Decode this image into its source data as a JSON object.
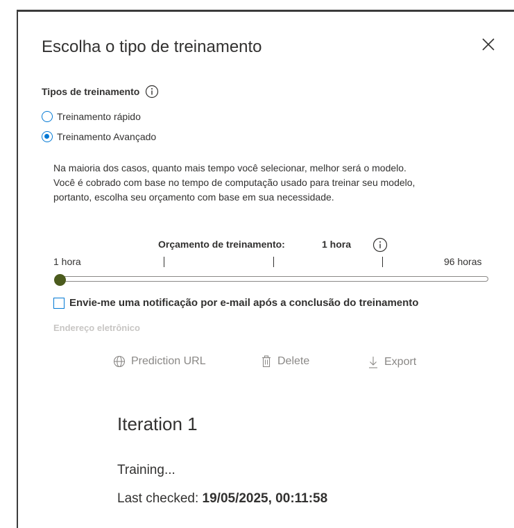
{
  "dialog": {
    "title": "Escolha o tipo de treinamento",
    "close_icon": "close-icon"
  },
  "training_types": {
    "label": "Tipos de treinamento",
    "info_icon": "info-icon",
    "options": [
      {
        "label": "Treinamento rápido",
        "selected": false
      },
      {
        "label": "Treinamento Avançado",
        "selected": true
      }
    ]
  },
  "description": [
    "Na maioria dos casos, quanto mais tempo você selecionar, melhor será o modelo.",
    "Você é cobrado com base no tempo de computação usado para treinar seu modelo,",
    "portanto, escolha seu orçamento com base em sua necessidade."
  ],
  "budget": {
    "label": "Orçamento de treinamento:",
    "value": "1 hora",
    "info_icon": "info-icon",
    "min_label": "1 hora",
    "max_label": "96 horas",
    "min_hours": 1,
    "max_hours": 96,
    "current_hours": 1,
    "thumb_color": "#4b5b1d"
  },
  "notification": {
    "label": "Envie-me uma notificação por e-mail após a conclusão do treinamento",
    "checked": false
  },
  "email_field": {
    "label": "Endereço eletrônico"
  },
  "toolbar": {
    "prediction_url": {
      "label": "Prediction URL",
      "icon": "globe-icon"
    },
    "delete": {
      "label": "Delete",
      "icon": "trash-icon"
    },
    "export": {
      "label": "Export",
      "icon": "download-icon"
    }
  },
  "iteration": {
    "title": "Iteration 1",
    "status": "Training...",
    "last_checked_label": "Last checked:",
    "last_checked_value": "19/05/2025, 00:11:58"
  },
  "colors": {
    "accent": "#0078d4",
    "disabled_text": "#8a8886"
  }
}
